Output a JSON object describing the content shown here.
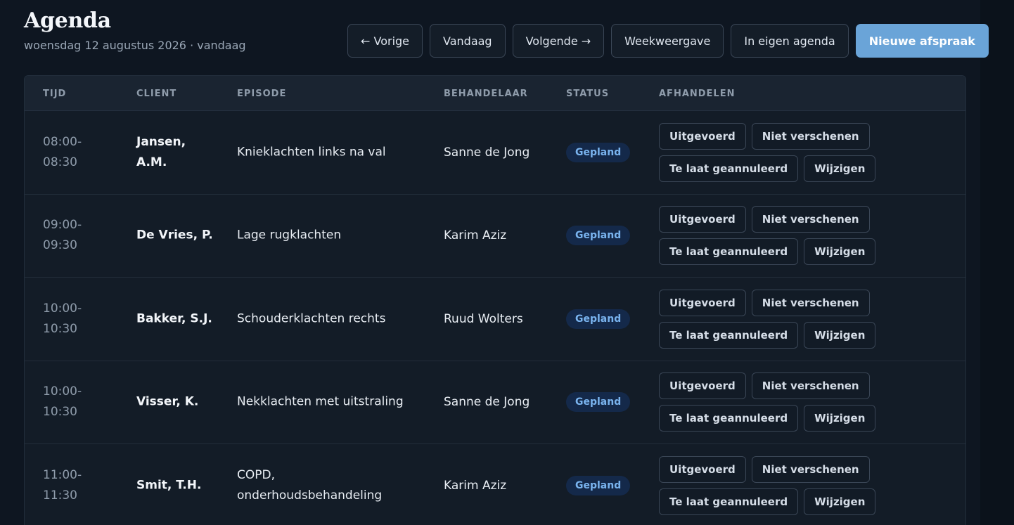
{
  "header": {
    "title": "Agenda",
    "subtitle": "woensdag 12 augustus 2026 · vandaag"
  },
  "toolbar": {
    "prev_label": "← Vorige",
    "today_label": "Vandaag",
    "next_label": "Volgende →",
    "week_label": "Weekweergave",
    "own_label": "In eigen agenda",
    "new_label": "Nieuwe afspraak"
  },
  "table": {
    "columns": [
      "TIJD",
      "CLIENT",
      "EPISODE",
      "BEHANDELAAR",
      "STATUS",
      "AFHANDELEN"
    ],
    "actions": {
      "done": "Uitgevoerd",
      "noshow": "Niet verschenen",
      "late_cancel": "Te laat geannuleerd",
      "edit": "Wijzigen"
    },
    "rows": [
      {
        "start": "08:00-",
        "end": "08:30",
        "client_1": "Jansen,",
        "client_2": "A.M.",
        "episode_1": "Knieklachten links na val",
        "episode_2": "",
        "behandelaar": "Sanne de Jong",
        "status": "Gepland"
      },
      {
        "start": "09:00-",
        "end": "09:30",
        "client_1": "De Vries, P.",
        "client_2": "",
        "episode_1": "Lage rugklachten",
        "episode_2": "",
        "behandelaar": "Karim Aziz",
        "status": "Gepland"
      },
      {
        "start": "10:00-",
        "end": "10:30",
        "client_1": "Bakker, S.J.",
        "client_2": "",
        "episode_1": "Schouderklachten rechts",
        "episode_2": "",
        "behandelaar": "Ruud Wolters",
        "status": "Gepland"
      },
      {
        "start": "10:00-",
        "end": "10:30",
        "client_1": "Visser, K.",
        "client_2": "",
        "episode_1": "Nekklachten met uitstraling",
        "episode_2": "",
        "behandelaar": "Sanne de Jong",
        "status": "Gepland"
      },
      {
        "start": "11:00-",
        "end": "11:30",
        "client_1": "Smit, T.H.",
        "client_2": "",
        "episode_1": "COPD,",
        "episode_2": "onderhoudsbehandeling",
        "behandelaar": "Karim Aziz",
        "status": "Gepland"
      }
    ]
  },
  "colors": {
    "background": "#0e1621",
    "primary": "#6aa4d8",
    "status_badge_bg": "#14294a",
    "status_badge_text": "#7ab4ef"
  }
}
